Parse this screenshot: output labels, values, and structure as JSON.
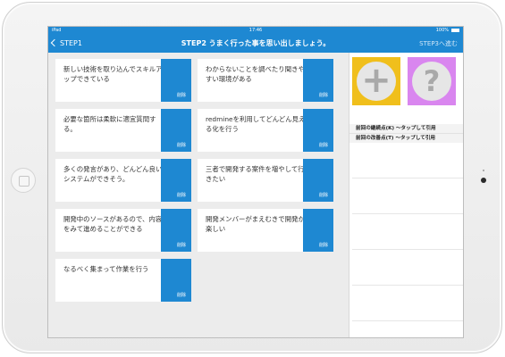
{
  "status_bar": {
    "carrier": "iPad",
    "time": "17:46",
    "battery": "100%"
  },
  "nav": {
    "back_label": "STEP1",
    "title": "STEP2 うまく行った事を思い出しましょう。",
    "next_label": "STEP3へ進む"
  },
  "cards": [
    {
      "text": "新しい技術を取り込んでスキルアップできている",
      "delete_label": "削除"
    },
    {
      "text": "わからないことを調べたり聞きやすい環境がある",
      "delete_label": "削除"
    },
    {
      "text": "必要な箇所は柔軟に適宜質問する。",
      "delete_label": "削除"
    },
    {
      "text": "redmineを利用してどんどん見える化を行う",
      "delete_label": "削除"
    },
    {
      "text": "多くの発言があり、どんどん良いシステムができそう。",
      "delete_label": "削除"
    },
    {
      "text": "三者で開発する案件を増やして行きたい",
      "delete_label": "削除"
    },
    {
      "text": "開発中のソースがあるので、内容をみて進めることができる",
      "delete_label": "削除"
    },
    {
      "text": "開発メンバーがまえむきで開発が楽しい",
      "delete_label": "削除"
    },
    {
      "text": "なるべく集まって作業を行う",
      "delete_label": "削除"
    }
  ],
  "sidebar": {
    "add_icon": "plus-icon",
    "add_glyph": "+",
    "help_icon": "question-icon",
    "help_glyph": "?",
    "add_color": "#f0bf1c",
    "help_color": "#d986ef",
    "ref_continue": "前回の継続点(K) ～タップして引用",
    "ref_improve": "前回の改善点(T) ～タップして引用"
  },
  "colors": {
    "accent": "#1e88d2",
    "background": "#ececec"
  }
}
